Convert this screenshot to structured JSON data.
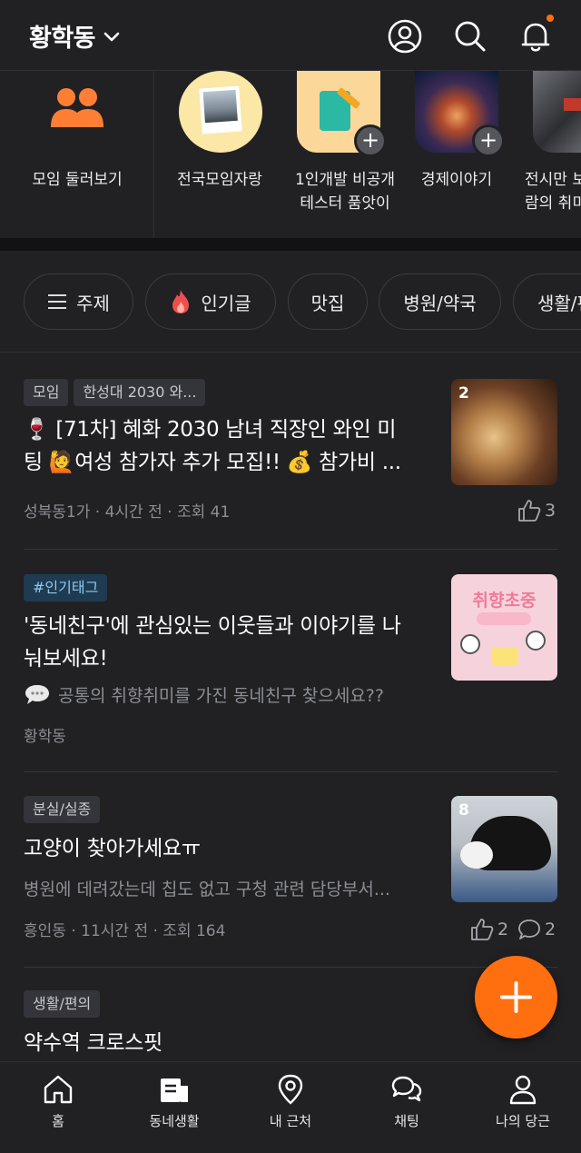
{
  "header": {
    "location": "황학동"
  },
  "groups": [
    {
      "label": "모임 둘러보기"
    },
    {
      "label": "전국모임자랑"
    },
    {
      "label": "1인개발 비공개\n테스터 품앗이"
    },
    {
      "label": "경제이야기"
    },
    {
      "label": "전시만 보\n람의 취미"
    }
  ],
  "chips": [
    {
      "label": "주제"
    },
    {
      "label": "인기글"
    },
    {
      "label": "맛집"
    },
    {
      "label": "병원/약국"
    },
    {
      "label": "생활/편의"
    }
  ],
  "posts": [
    {
      "tags": [
        "모임",
        "한성대 2030 와..."
      ],
      "title_line1": "🍷 [71차] 혜화 2030 남녀 직장인 와인 미",
      "title_line2": "팅 🙋여성 참가자 추가 모집!! 💰 참가비 ...",
      "meta": "성북동1가 · 4시간 전 · 조회 41",
      "image_count": "2",
      "likes": "3"
    },
    {
      "tags": [
        "#인기태그"
      ],
      "title_line1": "'동네친구'에 관심있는 이웃들과 이야기를 나",
      "title_line2": "눠보세요!",
      "subtitle": "공통의 취향취미를 가진 동네친구 찾으세요??",
      "meta": "황학동",
      "thumb_text": "취향초중"
    },
    {
      "tags": [
        "분실/실종"
      ],
      "title_line1": "고양이 찾아가세요ㅠ",
      "subtitle": "병원에 데려갔는데 칩도 없고 구청 관련 담당부서...",
      "meta": "흥인동 · 11시간 전 · 조회 164",
      "image_count": "8",
      "likes": "2",
      "comments": "2"
    },
    {
      "tags": [
        "생활/편의"
      ],
      "title_line1": "약수역 크로스핏"
    }
  ],
  "nav": [
    {
      "label": "홈"
    },
    {
      "label": "동네생활"
    },
    {
      "label": "내 근처"
    },
    {
      "label": "채팅"
    },
    {
      "label": "나의 당근"
    }
  ],
  "colors": {
    "accent": "#ff6f0f",
    "background": "#212124"
  }
}
